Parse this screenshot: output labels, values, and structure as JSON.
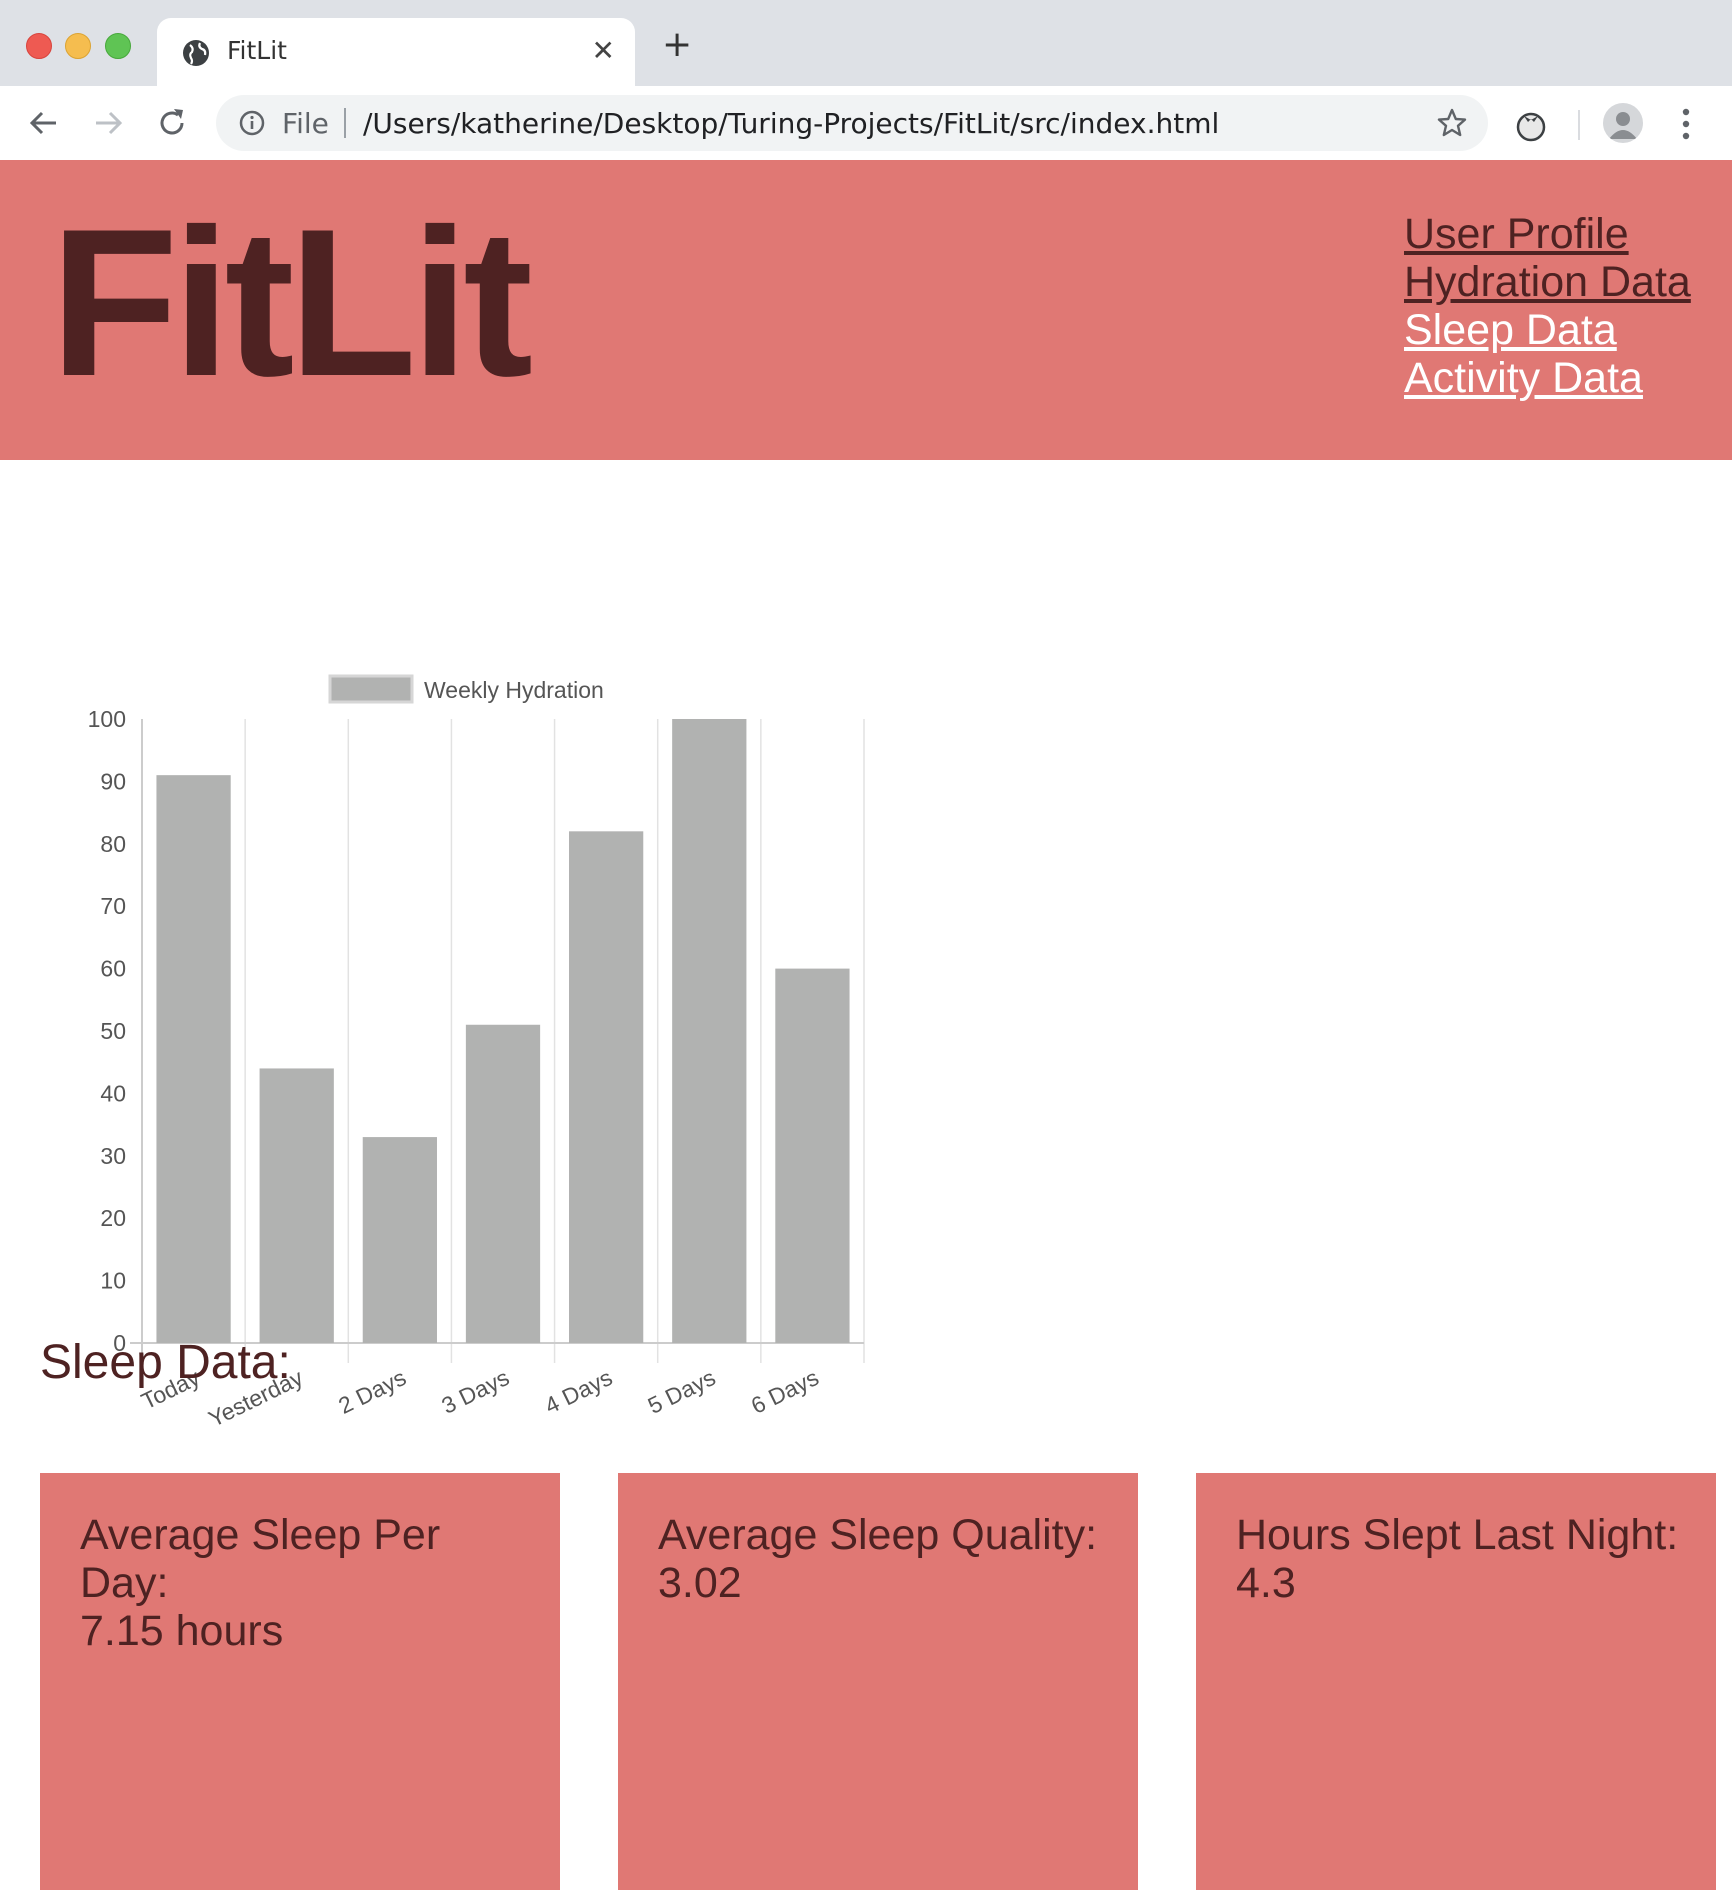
{
  "browser": {
    "tab_title": "FitLit",
    "address_scheme_label": "File",
    "address_url": "/Users/katherine/Desktop/Turing-Projects/FitLit/src/index.html"
  },
  "header": {
    "logo": "FitLit",
    "nav": [
      {
        "label": "User Profile"
      },
      {
        "label": "Hydration Data"
      },
      {
        "label": "Sleep Data"
      },
      {
        "label": "Activity Data"
      }
    ]
  },
  "chart_data": {
    "type": "bar",
    "categories": [
      "Today",
      "Yesterday",
      "2 Days",
      "3 Days",
      "4 Days",
      "5 Days",
      "6 Days"
    ],
    "series": [
      {
        "name": "Weekly Hydration",
        "values": [
          91,
          44,
          33,
          51,
          82,
          100,
          60
        ]
      }
    ],
    "title": "",
    "xlabel": "",
    "ylabel": "",
    "ylim": [
      0,
      100
    ],
    "yticks": [
      0,
      10,
      20,
      30,
      40,
      50,
      60,
      70,
      80,
      90,
      100
    ],
    "legend": "top",
    "grid": "vertical",
    "bar_color": "#b1b2b1"
  },
  "sleep": {
    "heading": "Sleep Data:",
    "cards": [
      {
        "label": "Average Sleep Per Day:",
        "value": "7.15 hours"
      },
      {
        "label": "Average Sleep Quality:",
        "value": "3.02"
      },
      {
        "label": "Hours Slept Last Night:",
        "value": "4.3"
      }
    ]
  },
  "colors": {
    "header_bg": "#e07874",
    "text_dark": "#4e2222",
    "link_light": "#ffffff"
  }
}
